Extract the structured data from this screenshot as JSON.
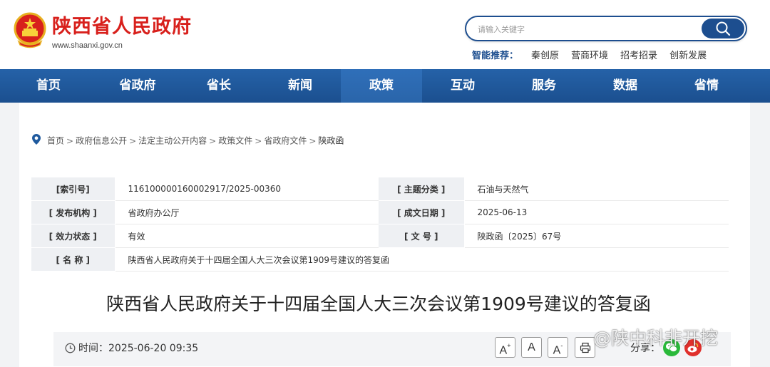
{
  "header": {
    "site_name": "陕西省人民政府",
    "site_url": "www.shaanxi.gov.cn",
    "search": {
      "placeholder": "请输入关键字"
    },
    "recommend": {
      "label": "智能推荐：",
      "items": [
        "秦创原",
        "营商环境",
        "招考招录",
        "创新发展"
      ]
    }
  },
  "nav": {
    "items": [
      "首页",
      "省政府",
      "省长",
      "新闻",
      "政策",
      "互动",
      "服务",
      "数据",
      "省情"
    ],
    "active": "政策"
  },
  "breadcrumb": [
    "首页",
    "政府信息公开",
    "法定主动公开内容",
    "政策文件",
    "省政府文件",
    "陕政函"
  ],
  "breadcrumb_sep": ">",
  "meta": {
    "index_label": "[索引号]",
    "index_value": "116100000160002917/2025-00360",
    "topic_label": "[ 主题分类 ]",
    "topic_value": "石油与天然气",
    "issuer_label": "[ 发布机构 ]",
    "issuer_value": "省政府办公厅",
    "date_label": "[ 成文日期 ]",
    "date_value": "2025-06-13",
    "status_label": "[ 效力状态 ]",
    "status_value": "有效",
    "docno_label": "[ 文 号 ]",
    "docno_value": "陕政函〔2025〕67号",
    "name_label": "[ 名 称 ]",
    "name_value": "陕西省人民政府关于十四届全国人大三次会议第1909号建议的答复函"
  },
  "document": {
    "title": "陕西省人民政府关于十四届全国人大三次会议第1909号建议的答复函",
    "time_label": "时间：",
    "time_value": "2025-06-20 09:35"
  },
  "toolbar": {
    "font_larger": "A",
    "font_larger_sup": "+",
    "font_normal": "A",
    "font_smaller": "A",
    "font_smaller_sup": "-",
    "share_label": "分享："
  },
  "watermark": "@陕中科非开挖",
  "colors": {
    "brand_red": "#d8201c",
    "nav_blue": "#1f5a9e",
    "search_blue": "#1d4e8f",
    "wechat_green": "#2ab93a",
    "weibo_red": "#e0302c"
  }
}
